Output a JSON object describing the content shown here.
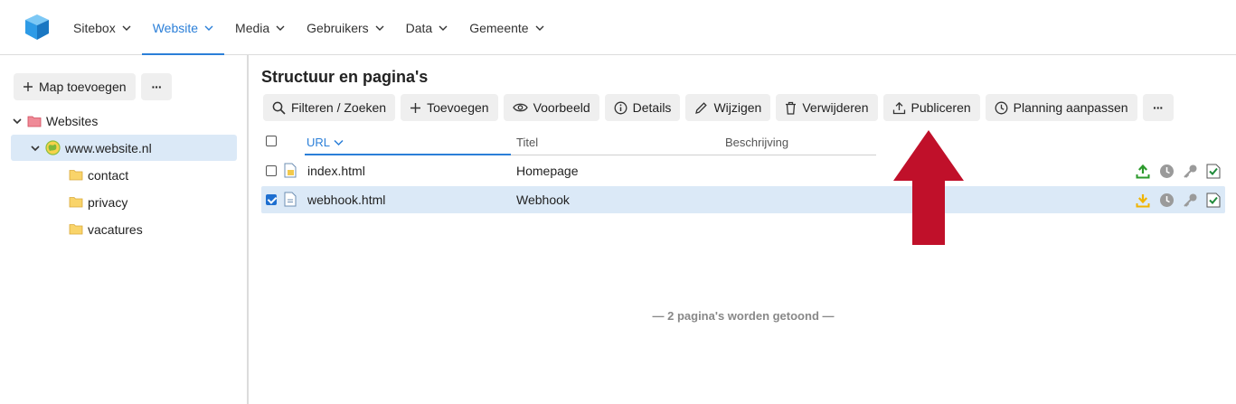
{
  "nav": {
    "items": [
      {
        "label": "Sitebox",
        "active": false
      },
      {
        "label": "Website",
        "active": true
      },
      {
        "label": "Media",
        "active": false
      },
      {
        "label": "Gebruikers",
        "active": false
      },
      {
        "label": "Data",
        "active": false
      },
      {
        "label": "Gemeente",
        "active": false
      }
    ],
    "accent": "#2b7fd8"
  },
  "sidebar": {
    "add_label": "Map toevoegen",
    "more_label": "···",
    "tree": [
      {
        "label": "Websites",
        "level": 0,
        "expanded": true,
        "icon": "folder-red-icon"
      },
      {
        "label": "www.website.nl",
        "level": 1,
        "expanded": true,
        "selected": true,
        "icon": "globe-icon"
      },
      {
        "label": "contact",
        "level": 2,
        "icon": "folder-icon"
      },
      {
        "label": "privacy",
        "level": 2,
        "icon": "folder-icon"
      },
      {
        "label": "vacatures",
        "level": 2,
        "icon": "folder-icon"
      }
    ]
  },
  "main": {
    "title": "Structuur en pagina's",
    "toolbar": {
      "filter": "Filteren / Zoeken",
      "add": "Toevoegen",
      "preview": "Voorbeeld",
      "details": "Details",
      "edit": "Wijzigen",
      "delete": "Verwijderen",
      "publish": "Publiceren",
      "schedule": "Planning aanpassen",
      "more": "···"
    },
    "columns": {
      "url": "URL",
      "title": "Titel",
      "description": "Beschrijving"
    },
    "rows": [
      {
        "url": "index.html",
        "title": "Homepage",
        "description": "",
        "checked": false,
        "status_icon": "upload-green-icon"
      },
      {
        "url": "webhook.html",
        "title": "Webhook",
        "description": "",
        "checked": true,
        "status_icon": "download-yellow-icon"
      }
    ],
    "footer": "— 2 pagina's worden getoond —"
  },
  "colors": {
    "selection": "#dbe9f7",
    "arrow": "#c0102a"
  }
}
